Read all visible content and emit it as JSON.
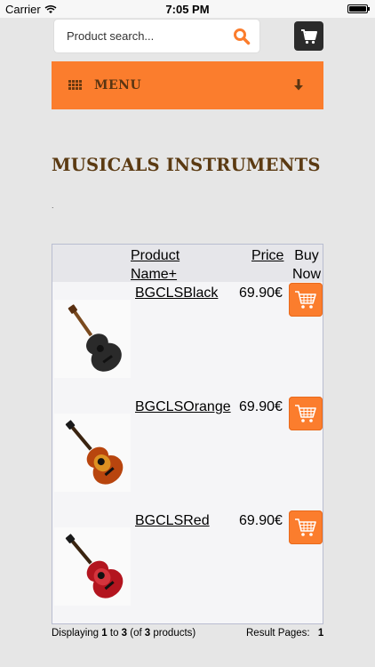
{
  "status_bar": {
    "carrier": "Carrier",
    "time": "7:05 PM",
    "icons": [
      "wifi-icon",
      "battery-icon"
    ]
  },
  "search": {
    "placeholder": "Product search...",
    "icon": "search-icon"
  },
  "cart": {
    "icon": "cart-icon"
  },
  "menu": {
    "label": "MENU",
    "left_icon": "grid-icon",
    "right_icon": "arrow-down-icon"
  },
  "page": {
    "title": "MUSICALS INSTRUMENTS",
    "dot": "."
  },
  "table": {
    "headers": {
      "name": "Product Name+",
      "price": "Price",
      "buy": "Buy Now"
    },
    "rows": [
      {
        "name": "BGCLSBlack",
        "price": "69.90€",
        "body_color": "#2a2a2a",
        "image_icon": "guitar-black-image"
      },
      {
        "name": "BGCLSOrange",
        "price": "69.90€",
        "body_color": "#b8450e",
        "image_icon": "guitar-orange-image"
      },
      {
        "name": "BGCLSRed",
        "price": "69.90€",
        "body_color": "#b3151f",
        "image_icon": "guitar-red-image"
      }
    ]
  },
  "footer": {
    "displaying_prefix": "Displaying",
    "from": "1",
    "to_word": "to",
    "to": "3",
    "of_open": "(of",
    "total": "3",
    "of_close": "products)",
    "pages_label": "Result Pages:",
    "page": "1"
  },
  "colors": {
    "accent": "#fb7d2d",
    "title": "#5b3a12",
    "background": "#e6e6e6"
  }
}
